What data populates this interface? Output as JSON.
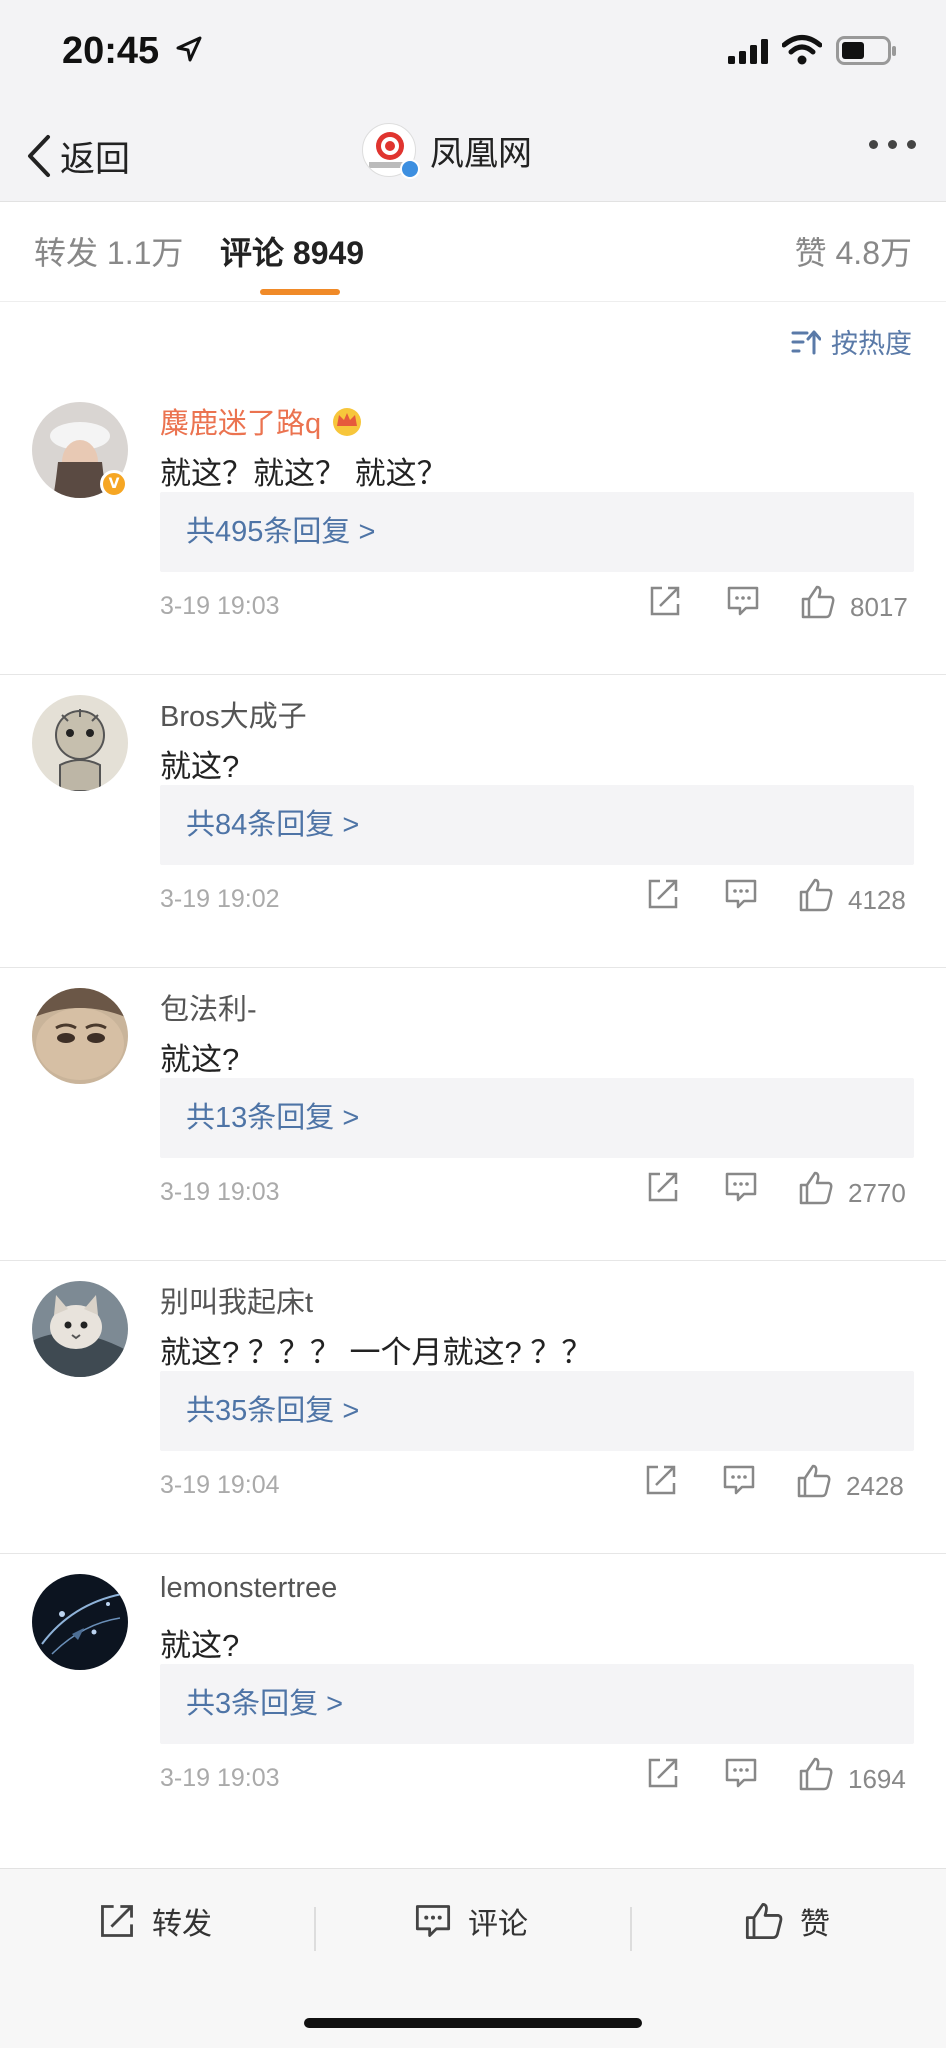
{
  "status_bar": {
    "time": "20:45"
  },
  "nav": {
    "back_label": "返回",
    "title": "凤凰网"
  },
  "tabs": [
    {
      "label": "转发 1.1万"
    },
    {
      "label": "评论 8949",
      "active": true
    },
    {
      "label": "赞 4.8万"
    }
  ],
  "sort": {
    "label": "按热度"
  },
  "comments": [
    {
      "user": "麋鹿迷了路q",
      "text": "就这？就这？ 就这？",
      "replies": "共495条回复 >",
      "time": "3-19 19:03",
      "likes": "8017"
    },
    {
      "user": "Bros大成子",
      "text": "就这?",
      "replies": "共84条回复 >",
      "time": "3-19 19:02",
      "likes": "4128"
    },
    {
      "user": "包法利-",
      "text": "就这?",
      "replies": "共13条回复 >",
      "time": "3-19 19:03",
      "likes": "2770"
    },
    {
      "user": "别叫我起床t",
      "text": "就这? ？？？ 一个月就这? ？？",
      "replies": "共35条回复 >",
      "time": "3-19 19:04",
      "likes": "2428"
    },
    {
      "user": "lemonstertree",
      "text": "就这?",
      "replies": "共3条回复 >",
      "time": "3-19 19:03",
      "likes": "1694"
    }
  ],
  "bottom_bar": {
    "repost": "转发",
    "comment": "评论",
    "like": "赞"
  },
  "colors": {
    "accent": "#f08a28",
    "link": "#4e74a6",
    "vip_name": "#eb7350"
  }
}
